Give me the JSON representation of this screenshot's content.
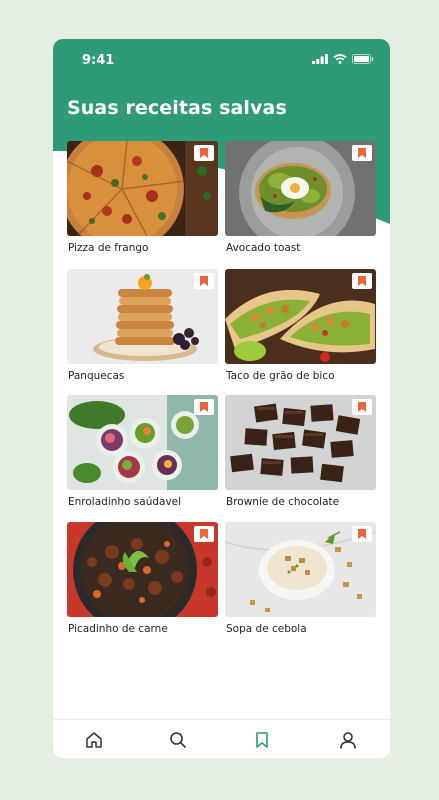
{
  "status": {
    "time": "9:41"
  },
  "header": {
    "title": "Suas receitas salvas"
  },
  "colors": {
    "brand": "#2e9a78",
    "bookmark": "#e8663c",
    "background": "#e4efe2"
  },
  "recipes": [
    {
      "name": "Pizza de frango",
      "icon": "bookmark-icon"
    },
    {
      "name": "Avocado toast",
      "icon": "bookmark-icon"
    },
    {
      "name": "Panquecas",
      "icon": "bookmark-icon"
    },
    {
      "name": "Taco de grão de bico",
      "icon": "bookmark-icon"
    },
    {
      "name": "Enroladinho saúdavel",
      "icon": "bookmark-icon"
    },
    {
      "name": "Brownie de chocolate",
      "icon": "bookmark-icon"
    },
    {
      "name": "Picadinho de carne",
      "icon": "bookmark-icon"
    },
    {
      "name": "Sopa de cebola",
      "icon": "bookmark-icon"
    }
  ],
  "nav": {
    "items": [
      "home-icon",
      "search-icon",
      "bookmark-icon",
      "profile-icon"
    ],
    "active": "bookmark-icon"
  }
}
